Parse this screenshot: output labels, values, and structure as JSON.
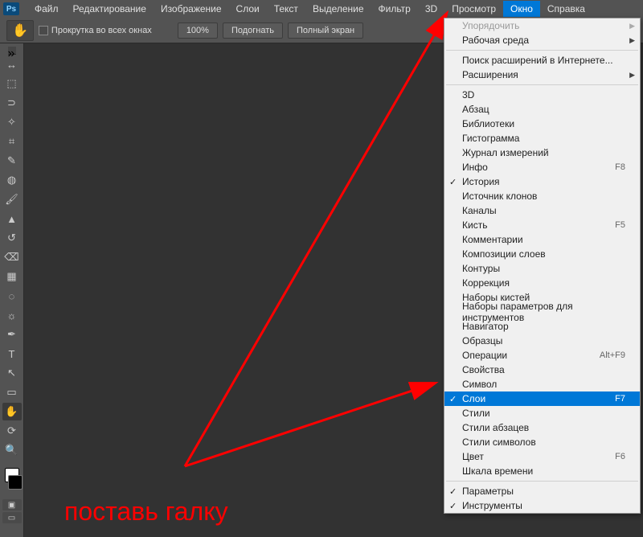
{
  "app_logo": "Ps",
  "menu": {
    "file": "Файл",
    "edit": "Редактирование",
    "image": "Изображение",
    "layers": "Слои",
    "text": "Текст",
    "select": "Выделение",
    "filter": "Фильтр",
    "threeD": "3D",
    "view": "Просмотр",
    "window": "Окно",
    "help": "Справка"
  },
  "options": {
    "scroll_all": "Прокрутка во всех окнах",
    "zoom": "100%",
    "fit": "Подогнать",
    "fullscreen": "Полный экран"
  },
  "dropdown": {
    "arrange": "Упорядочить",
    "workspace": "Рабочая среда",
    "browse_ext": "Поиск расширений в Интернете...",
    "extensions": "Расширения",
    "items": [
      {
        "label": "3D"
      },
      {
        "label": "Абзац"
      },
      {
        "label": "Библиотеки"
      },
      {
        "label": "Гистограмма"
      },
      {
        "label": "Журнал измерений"
      },
      {
        "label": "Инфо",
        "shortcut": "F8"
      },
      {
        "label": "История",
        "checked": true
      },
      {
        "label": "Источник клонов"
      },
      {
        "label": "Каналы"
      },
      {
        "label": "Кисть",
        "shortcut": "F5"
      },
      {
        "label": "Комментарии"
      },
      {
        "label": "Композиции слоев"
      },
      {
        "label": "Контуры"
      },
      {
        "label": "Коррекция"
      },
      {
        "label": "Наборы кистей"
      },
      {
        "label": "Наборы параметров для инструментов"
      },
      {
        "label": "Навигатор"
      },
      {
        "label": "Образцы"
      },
      {
        "label": "Операции",
        "shortcut": "Alt+F9"
      },
      {
        "label": "Свойства"
      },
      {
        "label": "Символ"
      },
      {
        "label": "Слои",
        "shortcut": "F7",
        "checked": true,
        "highlight": true
      },
      {
        "label": "Стили"
      },
      {
        "label": "Стили абзацев"
      },
      {
        "label": "Стили символов"
      },
      {
        "label": "Цвет",
        "shortcut": "F6"
      },
      {
        "label": "Шкала времени"
      }
    ],
    "params": "Параметры",
    "tools": "Инструменты"
  },
  "annotation": "поставь галку",
  "tools": {
    "move": "↔",
    "marquee": "⬚",
    "lasso": "⊃",
    "wand": "✧",
    "crop": "⌗",
    "eyedrop": "✎",
    "heal": "◍",
    "brush": "🖌",
    "stamp": "▲",
    "history": "↺",
    "eraser": "⌫",
    "gradient": "▦",
    "blur": "◌",
    "dodge": "☼",
    "pen": "✒",
    "type": "T",
    "path": "↖",
    "shape": "▭",
    "hand": "✋",
    "rotate": "⟳",
    "zoom": "🔍"
  }
}
